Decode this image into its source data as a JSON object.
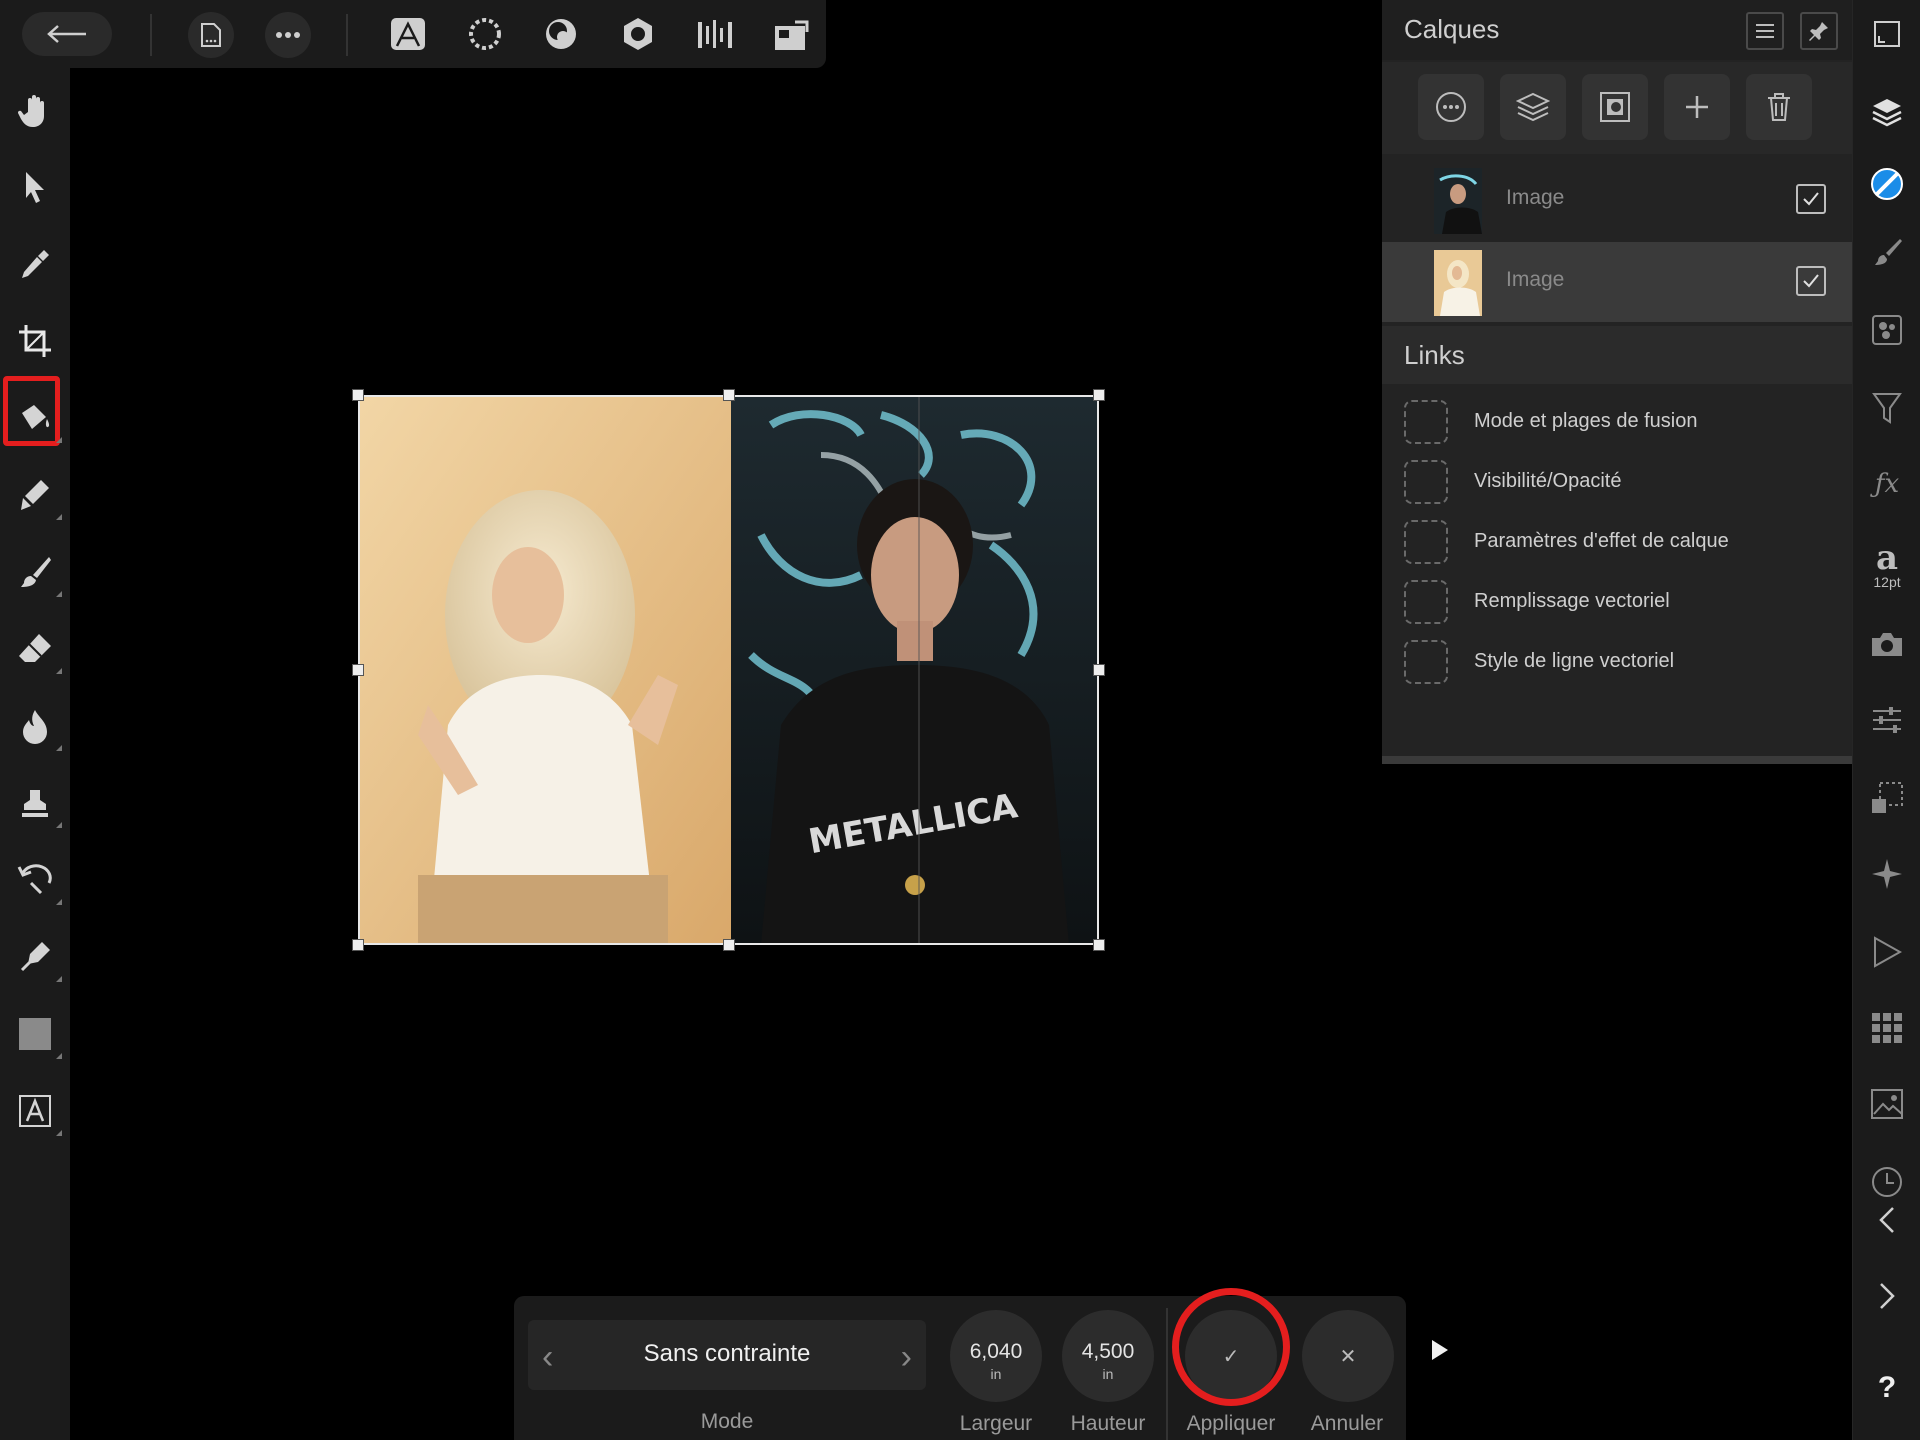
{
  "top_toolbar": {
    "back": "back-arrow-icon",
    "items": [
      "document-icon",
      "more-icon",
      "photo-persona-icon",
      "liquify-persona-icon",
      "develop-persona-icon",
      "tone-mapping-persona-icon",
      "export-persona-icon",
      "studio-layout-icon"
    ]
  },
  "tools": [
    "hand-tool",
    "move-tool",
    "color-picker-tool",
    "crop-tool",
    "flood-fill-tool",
    "selection-brush-tool",
    "paint-brush-tool",
    "erase-brush-tool",
    "burn-dodge-tool",
    "clone-tool",
    "undo-brush-tool",
    "pen-tool",
    "rectangle-tool",
    "artistic-text-tool"
  ],
  "layers_panel": {
    "title": "Calques",
    "layers": [
      {
        "name": "Image",
        "checked": true,
        "selected": false
      },
      {
        "name": "Image",
        "checked": true,
        "selected": true
      }
    ],
    "links_title": "Links",
    "links": [
      "Mode et plages de fusion",
      "Visibilité/Opacité",
      "Paramètres d'effet de calque",
      "Remplissage vectoriel",
      "Style de ligne vectoriel"
    ]
  },
  "right_studio": {
    "font_size_label": "12pt",
    "help": "?"
  },
  "context_bar": {
    "mode_value": "Sans contrainte",
    "mode_label": "Mode",
    "width_value": "6,040",
    "width_unit": "in",
    "width_label": "Largeur",
    "height_value": "4,500",
    "height_unit": "in",
    "height_label": "Hauteur",
    "apply_glyph": "✓",
    "apply_label": "Appliquer",
    "cancel_glyph": "✕",
    "cancel_label": "Annuler"
  },
  "colors": {
    "highlight": "#e41e1e",
    "panel_bg": "#232323",
    "toolbar_bg": "#1b1b1b"
  }
}
